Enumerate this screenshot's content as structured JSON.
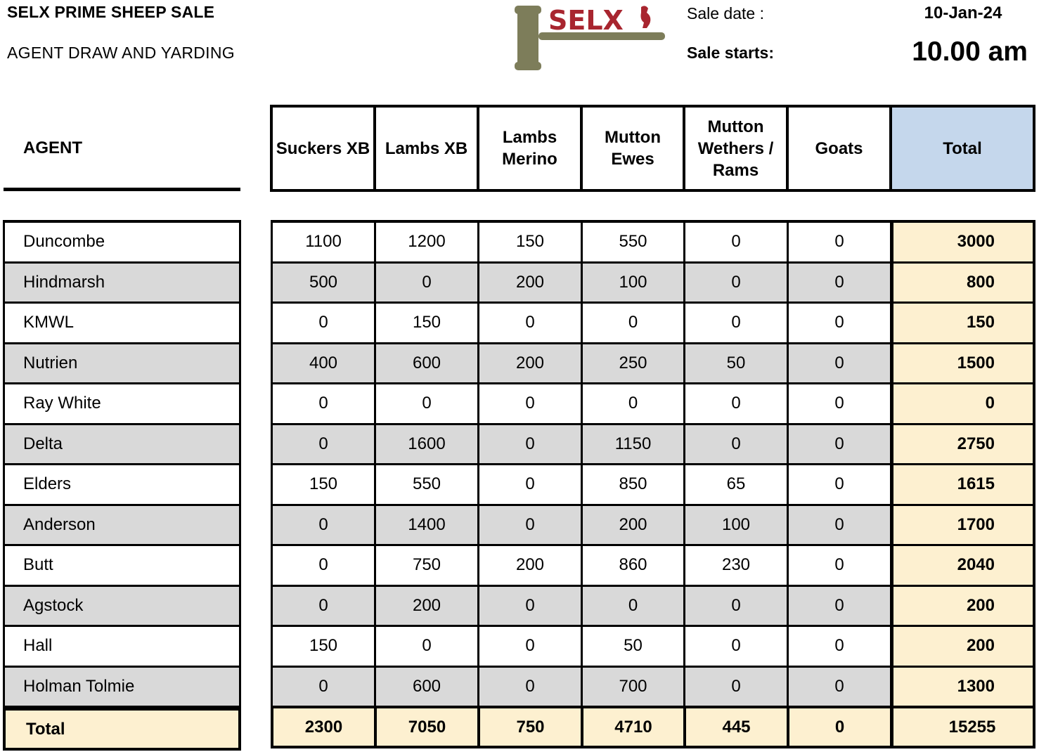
{
  "header": {
    "title": "SELX PRIME SHEEP SALE",
    "subtitle": "AGENT DRAW AND YARDING",
    "logo_text": "SELX",
    "sale_date_label": "Sale date :",
    "sale_date_value": "10-Jan-24",
    "sale_starts_label": "Sale starts:",
    "sale_starts_value": "10.00 am"
  },
  "colors": {
    "total_header_bg": "#c5d7ec",
    "total_cell_bg": "#fdf0d0",
    "alt_row_bg": "#d9d9d9",
    "logo_red": "#a8252f",
    "logo_olive": "#7d7d5a"
  },
  "table": {
    "agent_header": "AGENT",
    "columns": [
      "Suckers XB",
      "Lambs XB",
      "Lambs\nMerino",
      "Mutton\nEwes",
      "Mutton\nWethers /\nRams",
      "Goats",
      "Total"
    ],
    "rows": [
      {
        "agent": "Duncombe",
        "values": [
          "1100",
          "1200",
          "150",
          "550",
          "0",
          "0"
        ],
        "total": "3000"
      },
      {
        "agent": "Hindmarsh",
        "values": [
          "500",
          "0",
          "200",
          "100",
          "0",
          "0"
        ],
        "total": "800"
      },
      {
        "agent": "KMWL",
        "values": [
          "0",
          "150",
          "0",
          "0",
          "0",
          "0"
        ],
        "total": "150"
      },
      {
        "agent": "Nutrien",
        "values": [
          "400",
          "600",
          "200",
          "250",
          "50",
          "0"
        ],
        "total": "1500"
      },
      {
        "agent": "Ray White",
        "values": [
          "0",
          "0",
          "0",
          "0",
          "0",
          "0"
        ],
        "total": "0"
      },
      {
        "agent": "Delta",
        "values": [
          "0",
          "1600",
          "0",
          "1150",
          "0",
          "0"
        ],
        "total": "2750"
      },
      {
        "agent": "Elders",
        "values": [
          "150",
          "550",
          "0",
          "850",
          "65",
          "0"
        ],
        "total": "1615"
      },
      {
        "agent": "Anderson",
        "values": [
          "0",
          "1400",
          "0",
          "200",
          "100",
          "0"
        ],
        "total": "1700"
      },
      {
        "agent": "Butt",
        "values": [
          "0",
          "750",
          "200",
          "860",
          "230",
          "0"
        ],
        "total": "2040"
      },
      {
        "agent": "Agstock",
        "values": [
          "0",
          "200",
          "0",
          "0",
          "0",
          "0"
        ],
        "total": "200"
      },
      {
        "agent": "Hall",
        "values": [
          "150",
          "0",
          "0",
          "50",
          "0",
          "0"
        ],
        "total": "200"
      },
      {
        "agent": "Holman Tolmie",
        "values": [
          "0",
          "600",
          "0",
          "700",
          "0",
          "0"
        ],
        "total": "1300"
      }
    ],
    "total_row": {
      "label": "Total",
      "values": [
        "2300",
        "7050",
        "750",
        "4710",
        "445",
        "0"
      ],
      "total": "15255"
    }
  }
}
